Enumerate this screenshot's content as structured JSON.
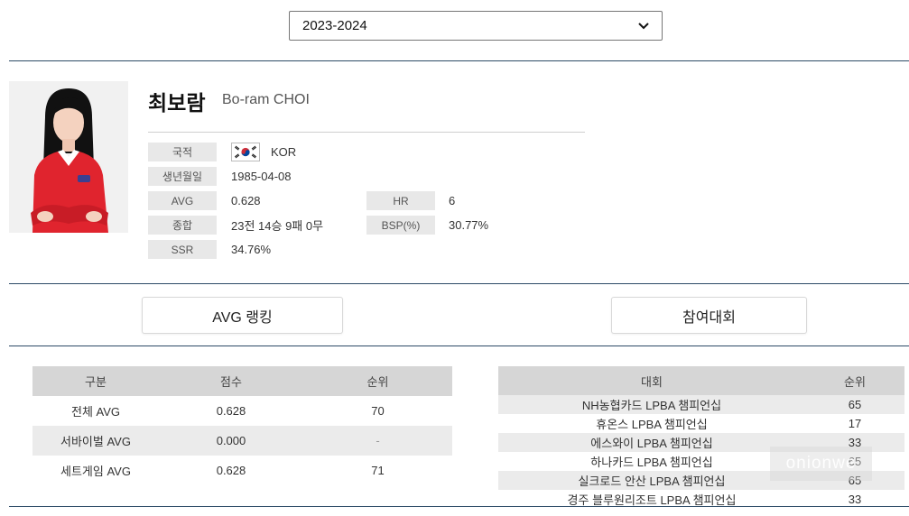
{
  "season": {
    "selected": "2023-2024"
  },
  "player": {
    "name_ko": "최보람",
    "name_en": "Bo-ram CHOI",
    "fields": {
      "nationality_label": "국적",
      "nationality_value": "KOR",
      "birth_label": "생년월일",
      "birth_value": "1985-04-08",
      "avg_label": "AVG",
      "avg_value": "0.628",
      "hr_label": "HR",
      "hr_value": "6",
      "record_label": "종합",
      "record_value": "23전 14승 9패 0무",
      "bsp_label": "BSP(%)",
      "bsp_value": "30.77%",
      "ssr_label": "SSR",
      "ssr_value": "34.76%"
    }
  },
  "tabs": {
    "avg_ranking": "AVG 랭킹",
    "competitions": "참여대회"
  },
  "avg_table": {
    "headers": [
      "구분",
      "점수",
      "순위"
    ],
    "rows": [
      [
        "전체 AVG",
        "0.628",
        "70"
      ],
      [
        "서바이벌 AVG",
        "0.000",
        "-"
      ],
      [
        "세트게임 AVG",
        "0.628",
        "71"
      ]
    ]
  },
  "comp_table": {
    "headers": [
      "대회",
      "순위"
    ],
    "rows": [
      [
        "NH농협카드 LPBA 챔피언십",
        "65"
      ],
      [
        "휴온스 LPBA 챔피언십",
        "17"
      ],
      [
        "에스와이 LPBA 챔피언십",
        "33"
      ],
      [
        "하나카드 LPBA 챔피언십",
        "65"
      ],
      [
        "실크로드 안산 LPBA 챔피언십",
        "65"
      ],
      [
        "경주 블루원리조트 LPBA 챔피언십",
        "33"
      ]
    ]
  },
  "watermark": "onionwe",
  "colors": {
    "rule": "#2c4a66",
    "label_bg": "#e8e8e8",
    "header_bg": "#d6d6d6",
    "alt_row_bg": "#ebebeb",
    "shirt_red": "#e0242e"
  },
  "icons": {
    "flag": "korea-flag-icon",
    "dropdown": "chevron-down-icon"
  }
}
